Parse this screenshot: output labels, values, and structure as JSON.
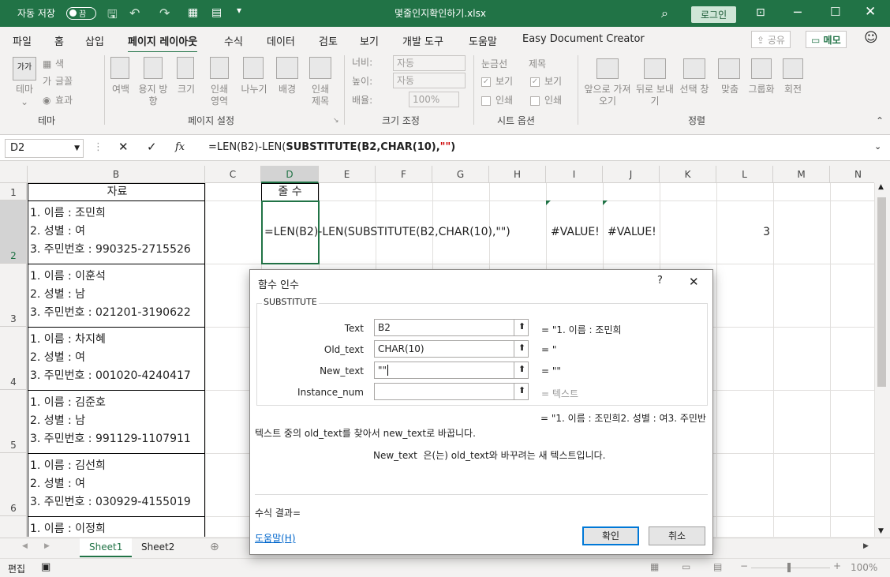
{
  "titlebar": {
    "autosave_label": "자동 저장",
    "autosave_state": "끔",
    "filename": "몇줄인지확인하기.xlsx",
    "login_label": "로그인"
  },
  "menu": {
    "tabs": [
      "파일",
      "홈",
      "삽입",
      "페이지 레이아웃",
      "수식",
      "데이터",
      "검토",
      "보기",
      "개발 도구",
      "도움말",
      "Easy Document Creator"
    ],
    "active": "페이지 레이아웃",
    "share_label": "공유",
    "memo_label": "메모"
  },
  "ribbon": {
    "theme": {
      "label": "테마",
      "buttons": [
        "테마",
        "색",
        "글꼴",
        "효과"
      ]
    },
    "page_setup": {
      "label": "페이지 설정",
      "buttons": [
        "여백",
        "용지 방향",
        "크기",
        "인쇄 영역",
        "나누기",
        "배경",
        "인쇄 제목"
      ]
    },
    "scale": {
      "label": "크기 조정",
      "width_label": "너비:",
      "width_value": "자동",
      "height_label": "높이:",
      "height_value": "자동",
      "scale_label": "배율:",
      "scale_value": "100%"
    },
    "sheet_options": {
      "label": "시트 옵션",
      "gridlines_label": "눈금선",
      "headings_label": "제목",
      "view_label": "보기",
      "print_label": "인쇄"
    },
    "arrange": {
      "label": "정렬",
      "buttons": [
        "앞으로 가져오기",
        "뒤로 보내기",
        "선택 창",
        "맞춤",
        "그룹화",
        "회전"
      ]
    }
  },
  "formula_bar": {
    "name_box": "D2",
    "fx": "fx",
    "formula_prefix": "=LEN(B2)-LEN(",
    "formula_bold": "SUBSTITUTE(B2,CHAR(10),",
    "formula_red": "\"\"",
    "formula_close": ")"
  },
  "sheet": {
    "columns": [
      "B",
      "C",
      "D",
      "E",
      "F",
      "G",
      "H",
      "I",
      "J",
      "K",
      "L",
      "M",
      "N"
    ],
    "header_B": "자료",
    "header_D": "줄 수",
    "row_numbers": [
      "1",
      "2",
      "3",
      "4",
      "5",
      "6"
    ],
    "rows": [
      {
        "l1": "1. 이름 : 조민희",
        "l2": "2. 성별 : 여",
        "l3": "3. 주민번호 : 990325-2715526"
      },
      {
        "l1": "1. 이름 : 이훈석",
        "l2": "2. 성별 : 남",
        "l3": "3. 주민번호 : 021201-3190622"
      },
      {
        "l1": "1. 이름 : 차지혜",
        "l2": "2. 성별 : 여",
        "l3": "3. 주민번호 : 001020-4240417"
      },
      {
        "l1": "1. 이름 : 김준호",
        "l2": "2. 성별 : 남",
        "l3": "3. 주민번호 : 991129-1107911"
      },
      {
        "l1": "1. 이름 : 김선희",
        "l2": "2. 성별 : 여",
        "l3": "3. 주민번호 : 030929-4155019"
      },
      {
        "l1": "1. 이름 : 이정희"
      }
    ],
    "d2_formula": "=LEN(B2)-LEN(SUBSTITUTE(B2,CHAR(10),\"\")",
    "i2": "#VALUE!",
    "j2": "#VALUE!",
    "l2": "3",
    "sheet_tabs": [
      "Sheet1",
      "Sheet2"
    ],
    "active_tab": "Sheet1",
    "status_mode": "편집",
    "zoom": "100%"
  },
  "dialog": {
    "title": "함수 인수",
    "help_q": "?",
    "function_name": "SUBSTITUTE",
    "args": [
      {
        "label": "Text",
        "value": "B2",
        "result": "= \"1. 이름 : 조민희"
      },
      {
        "label": "Old_text",
        "value": "CHAR(10)",
        "result": "= \""
      },
      {
        "label": "New_text",
        "value": "\"\"",
        "result": "= \"\""
      },
      {
        "label": "Instance_num",
        "value": "",
        "result": "= 텍스트"
      }
    ],
    "overall_result": "= \"1. 이름 : 조민희2. 성별 : 여3. 주민반",
    "description": "텍스트 중의 old_text를 찾아서 new_text로 바꿉니다.",
    "arg_help": "New_text  은(는) old_text와 바꾸려는 새 텍스트입니다.",
    "formula_result_label": "수식 결과=",
    "help_link": "도움말(H)",
    "ok_label": "확인",
    "cancel_label": "취소"
  }
}
